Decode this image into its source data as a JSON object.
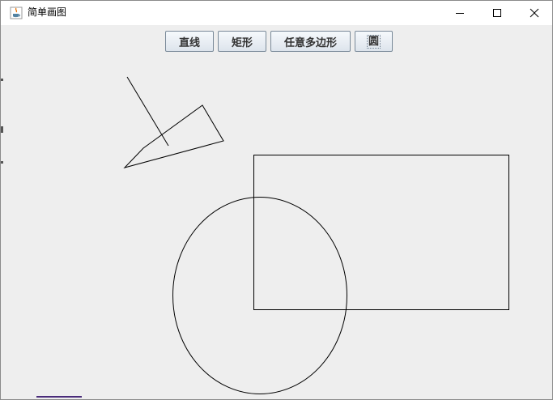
{
  "window": {
    "title": "简单画图",
    "icon": "java-coffee-cup-icon",
    "controls": {
      "minimize_icon": "minimize-icon",
      "maximize_icon": "maximize-icon",
      "close_icon": "close-icon"
    }
  },
  "toolbar": {
    "buttons": [
      {
        "id": "line",
        "label": "直线"
      },
      {
        "id": "rect",
        "label": "矩形"
      },
      {
        "id": "polygon",
        "label": "任意多边形"
      },
      {
        "id": "circle",
        "label": "圆"
      }
    ]
  },
  "canvas": {
    "background": "#eeeeee",
    "stroke": "#000000"
  }
}
